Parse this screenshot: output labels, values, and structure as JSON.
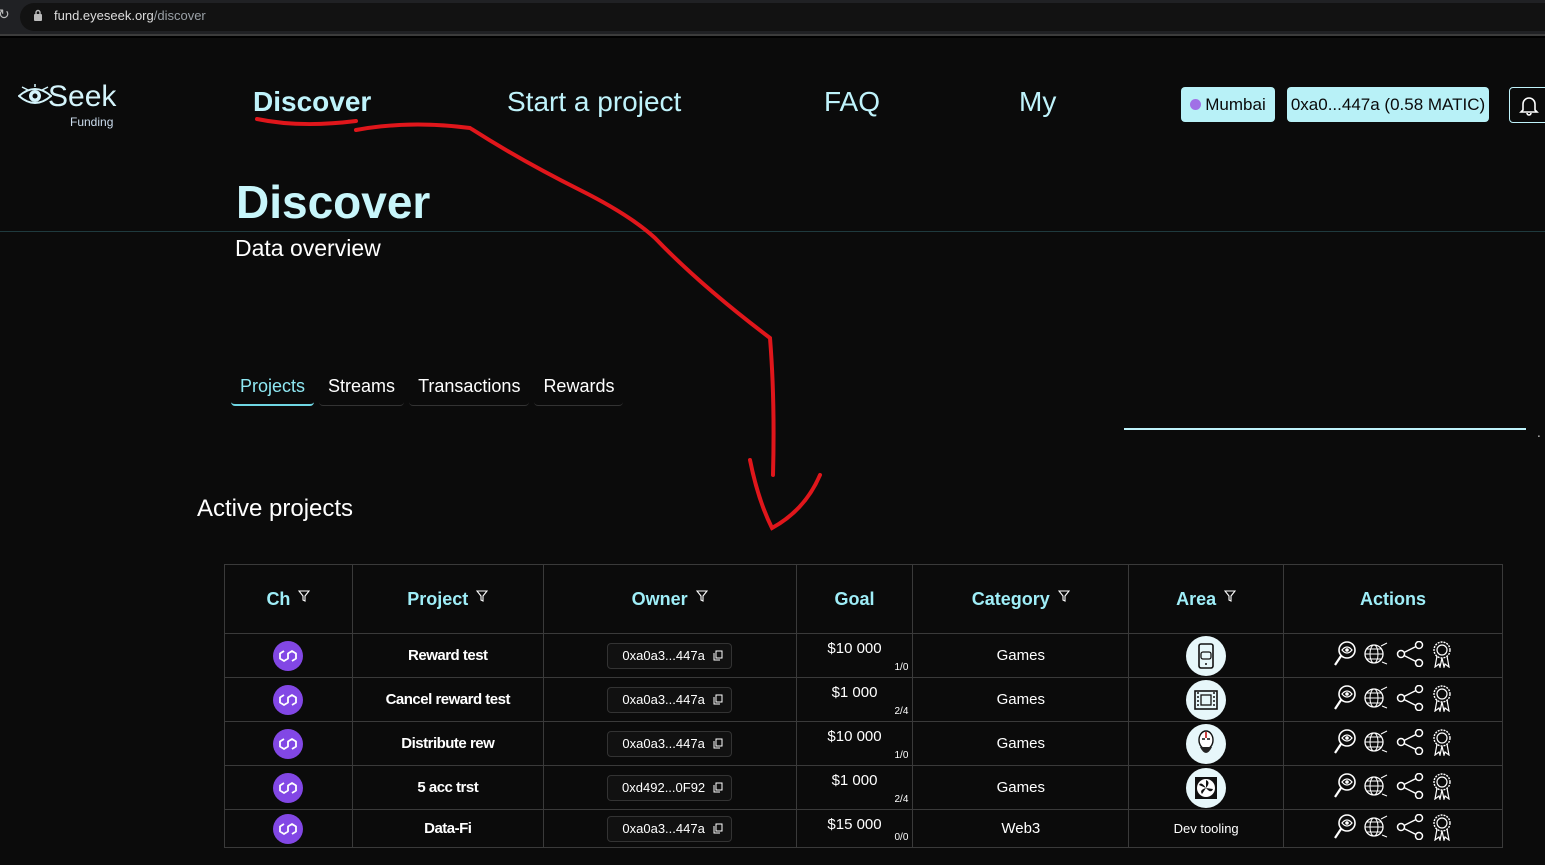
{
  "browser": {
    "url_host": "fund.eyeseek.org",
    "url_path": "/discover"
  },
  "logo": {
    "name": "Seek",
    "tagline": "Funding"
  },
  "nav": {
    "discover": "Discover",
    "start": "Start a project",
    "faq": "FAQ",
    "my": "My"
  },
  "header": {
    "network": "Mumbai",
    "wallet": "0xa0...447a (0.58 MATIC)"
  },
  "page": {
    "title": "Discover",
    "subtitle": "Data overview"
  },
  "tabs": [
    "Projects",
    "Streams",
    "Transactions",
    "Rewards"
  ],
  "section_title": "Active projects",
  "table": {
    "headers": {
      "ch": "Ch",
      "project": "Project",
      "owner": "Owner",
      "goal": "Goal",
      "category": "Category",
      "area": "Area",
      "actions": "Actions"
    },
    "rows": [
      {
        "project": "Reward test",
        "owner": "0xa0a3...447a",
        "goal": "$10 000",
        "ratio": "1/0",
        "category": "Games",
        "area": "mobile-game-icon"
      },
      {
        "project": "Cancel reward test",
        "owner": "0xa0a3...447a",
        "goal": "$1 000",
        "ratio": "2/4",
        "category": "Games",
        "area": "film-icon"
      },
      {
        "project": "Distribute rew",
        "owner": "0xa0a3...447a",
        "goal": "$10 000",
        "ratio": "1/0",
        "category": "Games",
        "area": "warrior-icon"
      },
      {
        "project": "5 acc trst",
        "owner": "0xd492...0F92",
        "goal": "$1 000",
        "ratio": "2/4",
        "category": "Games",
        "area": "fan-icon"
      },
      {
        "project": "Data-Fi",
        "owner": "0xa0a3...447a",
        "goal": "$15 000",
        "ratio": "0/0",
        "category": "Web3",
        "area_text": "Dev tooling"
      }
    ]
  },
  "colors": {
    "accent": "#bff3fb",
    "chip": "#b8f1f7",
    "polygon": "#8247e5",
    "annotation": "#e0161b"
  }
}
